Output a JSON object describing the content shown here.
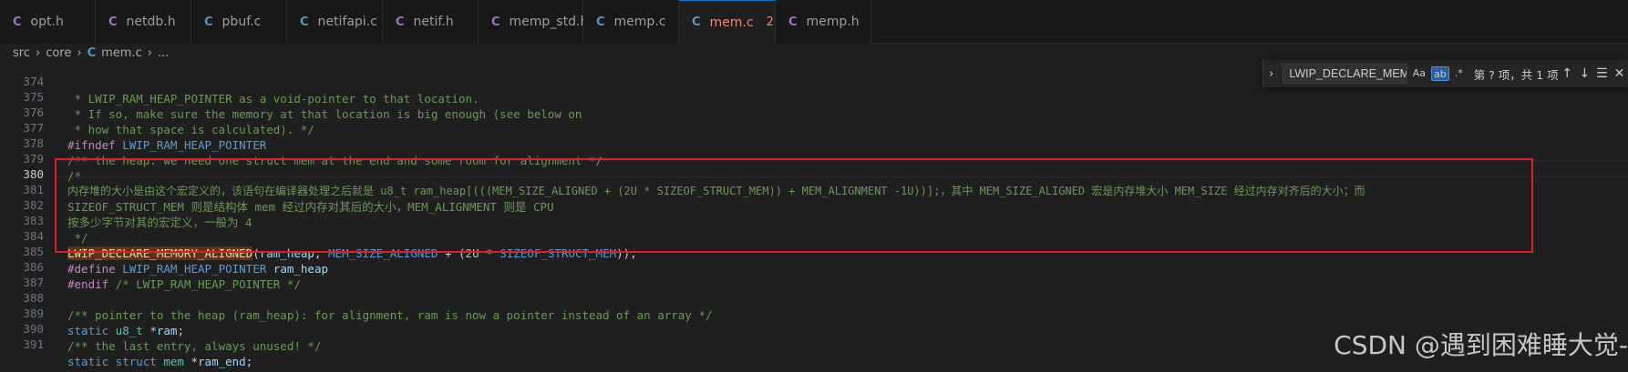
{
  "tabs": [
    {
      "label": "opt.h",
      "icon_color": "purple"
    },
    {
      "label": "netdb.h",
      "icon_color": "purple"
    },
    {
      "label": "pbuf.c",
      "icon_color": "blue"
    },
    {
      "label": "netifapi.c",
      "icon_color": "blue"
    },
    {
      "label": "netif.h",
      "icon_color": "purple"
    },
    {
      "label": "memp_std.h",
      "icon_color": "purple"
    },
    {
      "label": "memp.c",
      "icon_color": "blue"
    },
    {
      "label": "mem.c",
      "icon_color": "blue",
      "active": true,
      "problems": "2"
    },
    {
      "label": "memp.h",
      "icon_color": "purple"
    }
  ],
  "tab_icon_glyph": "C",
  "breadcrumb": {
    "seg1": "src",
    "seg2": "core",
    "file": "mem.c",
    "more": "..."
  },
  "find": {
    "value": "LWIP_DECLARE_MEMORY_ALIGNED",
    "opt_case": "Aa",
    "opt_word": "ab",
    "opt_regex": ".*",
    "result": "第 ? 项，共 1 项"
  },
  "lines": {
    "l374": {
      "no": "374",
      "t": " * LWIP_RAM_HEAP_POINTER as a void-pointer to that location."
    },
    "l375": {
      "no": "375",
      "t": " * If so, make sure the memory at that location is big enough (see below on"
    },
    "l376": {
      "no": "376",
      "t": " * how that space is calculated). */"
    },
    "l377": {
      "no": "377",
      "a": "#ifndef",
      "b": " LWIP_RAM_HEAP_POINTER"
    },
    "l378": {
      "no": "378",
      "t": "/** the heap. we need one struct mem at the end and some room for alignment */"
    },
    "l379": {
      "no": "379",
      "t": "/*"
    },
    "l380": {
      "no": "380",
      "t": "内存堆的大小是由这个宏定义的，该语句在编译器处理之后就是 u8_t ram_heap[(((MEM_SIZE_ALIGNED + (2U * SIZEOF_STRUCT_MEM)) + MEM_ALIGNMENT -1U))];，其中 MEM_SIZE_ALIGNED 宏是内存堆大小 MEM_SIZE 经过内存对齐后的大小；而"
    },
    "l381": {
      "no": "381",
      "t": "SIZEOF_STRUCT_MEM 则是结构体 mem 经过内存对其后的大小，MEM_ALIGNMENT 则是 CPU"
    },
    "l382": {
      "no": "382",
      "t": "按多少字节对其的宏定义，一般为 4"
    },
    "l383": {
      "no": "383",
      "t": " */"
    },
    "l384": {
      "no": "384",
      "fn": "LWIP_DECLARE_MEMORY_ALIGNED",
      "p1": "(",
      "v1": "ram_heap",
      "p2": ", ",
      "m1": "MEM_SIZE_ALIGNED",
      "p3": " + (",
      "n1": "2U",
      "p4": " * ",
      "m2": "SIZEOF_STRUCT_MEM",
      "p5": "));"
    },
    "l385": {
      "no": "385",
      "a": "#define",
      "b": " LWIP_RAM_HEAP_POINTER",
      "c": " ram_heap"
    },
    "l386": {
      "no": "386",
      "a": "#endif",
      "b": " /* LWIP_RAM_HEAP_POINTER */"
    },
    "l387": {
      "no": "387"
    },
    "l388": {
      "no": "388",
      "t": "/** pointer to the heap (ram_heap): for alignment, ram is now a pointer instead of an array */"
    },
    "l389": {
      "no": "389",
      "a": "static",
      "b": " u8_t",
      "c": " *",
      "d": "ram",
      "e": ";"
    },
    "l390": {
      "no": "390",
      "t": "/** the last entry, always unused! */"
    },
    "l391": {
      "no": "391",
      "a": "static",
      "b": " struct",
      "c": " mem",
      "d": " *",
      "e": "ram_end",
      "f": ";"
    }
  },
  "watermark": "CSDN @遇到困难睡大觉-"
}
